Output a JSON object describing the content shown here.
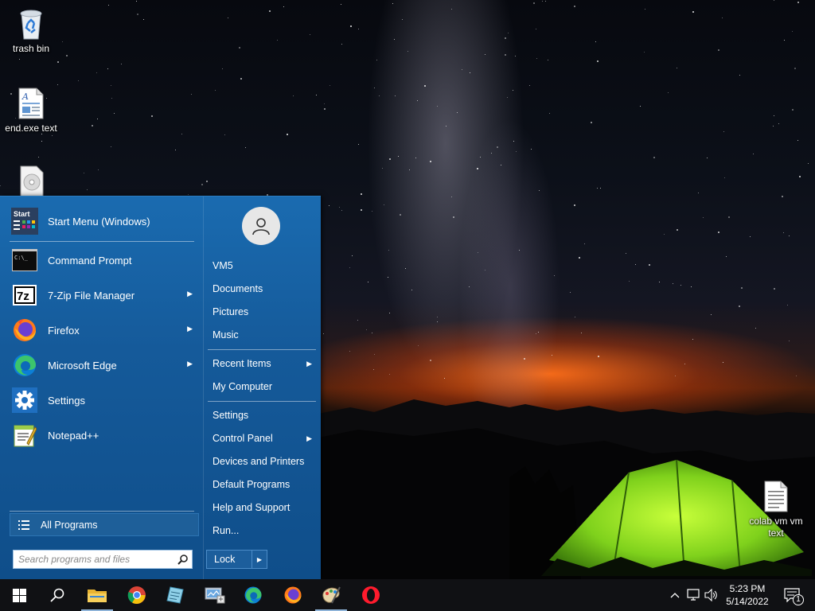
{
  "desktop": {
    "icons": [
      {
        "label": "trash bin",
        "icon": "recycle-bin-icon"
      },
      {
        "label": "end.exe text",
        "icon": "text-document-icon"
      },
      {
        "label": "",
        "icon": "disc-document-icon"
      },
      {
        "label": "colab vm vm text",
        "icon": "text-file-icon"
      }
    ]
  },
  "start_menu": {
    "pinned": [
      {
        "label": "Start Menu (Windows)",
        "icon": "start-menu-app-icon",
        "has_submenu": false
      },
      {
        "label": "Command Prompt",
        "icon": "command-prompt-icon",
        "has_submenu": false
      },
      {
        "label": "7-Zip File Manager",
        "icon": "7zip-icon",
        "has_submenu": true
      },
      {
        "label": "Firefox",
        "icon": "firefox-icon",
        "has_submenu": true
      },
      {
        "label": "Microsoft Edge",
        "icon": "edge-icon",
        "has_submenu": true
      },
      {
        "label": "Settings",
        "icon": "settings-gear-icon",
        "has_submenu": false
      },
      {
        "label": "Notepad++",
        "icon": "notepad-plus-plus-icon",
        "has_submenu": false
      }
    ],
    "start_icon_text": "Start",
    "cmd_icon_text": "C:\\_",
    "sevenzip_icon_text": "7z",
    "all_programs_label": "All Programs",
    "search_placeholder": "Search programs and files",
    "right_items": [
      {
        "label": "VM5",
        "has_submenu": false
      },
      {
        "label": "Documents",
        "has_submenu": false
      },
      {
        "label": "Pictures",
        "has_submenu": false
      },
      {
        "label": "Music",
        "has_submenu": false
      },
      {
        "label": "Recent Items",
        "has_submenu": true
      },
      {
        "label": "My Computer",
        "has_submenu": false
      },
      {
        "label": "Settings",
        "has_submenu": false
      },
      {
        "label": "Control Panel",
        "has_submenu": true
      },
      {
        "label": "Devices and Printers",
        "has_submenu": false
      },
      {
        "label": "Default Programs",
        "has_submenu": false
      },
      {
        "label": "Help and Support",
        "has_submenu": false
      },
      {
        "label": "Run...",
        "has_submenu": false
      }
    ],
    "lock_label": "Lock",
    "arrow_glyph": "▶"
  },
  "taskbar": {
    "buttons": [
      "start-button",
      "search-button",
      "file-explorer",
      "chrome",
      "notepad",
      "control-panel",
      "edge",
      "firefox",
      "paint",
      "opera"
    ],
    "time": "5:23 PM",
    "date": "5/14/2022",
    "notification_count": "1"
  },
  "colors": {
    "start_menu_bg": "#155a9a",
    "taskbar_bg": "#101114",
    "accent": "#8fb4d9"
  }
}
